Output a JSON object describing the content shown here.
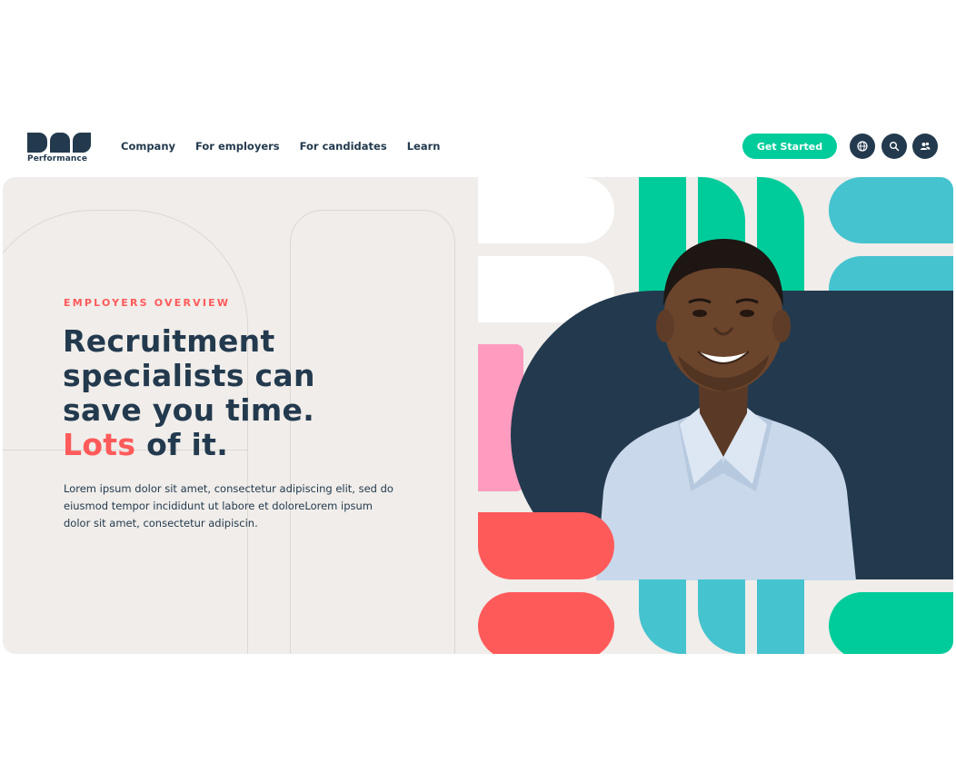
{
  "brand": {
    "logo_text": "Performance"
  },
  "nav": {
    "items": [
      {
        "label": "Company"
      },
      {
        "label": "For employers"
      },
      {
        "label": "For candidates"
      },
      {
        "label": "Learn"
      }
    ]
  },
  "header": {
    "cta_label": "Get Started",
    "icons": [
      "globe-icon",
      "search-icon",
      "user-icon"
    ]
  },
  "hero": {
    "eyebrow": "EMPLOYERS OVERVIEW",
    "headline_line1": "Recruitment",
    "headline_line2": "specialists can",
    "headline_line3": "save you time.",
    "headline_accent": "Lots",
    "headline_tail": " of it.",
    "body": "Lorem ipsum dolor sit amet, consectetur adipiscing elit, sed do eiusmod tempor incididunt ut labore et doloreLorem ipsum dolor sit amet, consectetur adipiscin."
  },
  "colors": {
    "navy": "#233a4e",
    "green": "#00cc9b",
    "coral": "#ff5a5a",
    "teal": "#45c3cf",
    "pink": "#ff9bbf",
    "hero_bg": "#f0edea"
  }
}
